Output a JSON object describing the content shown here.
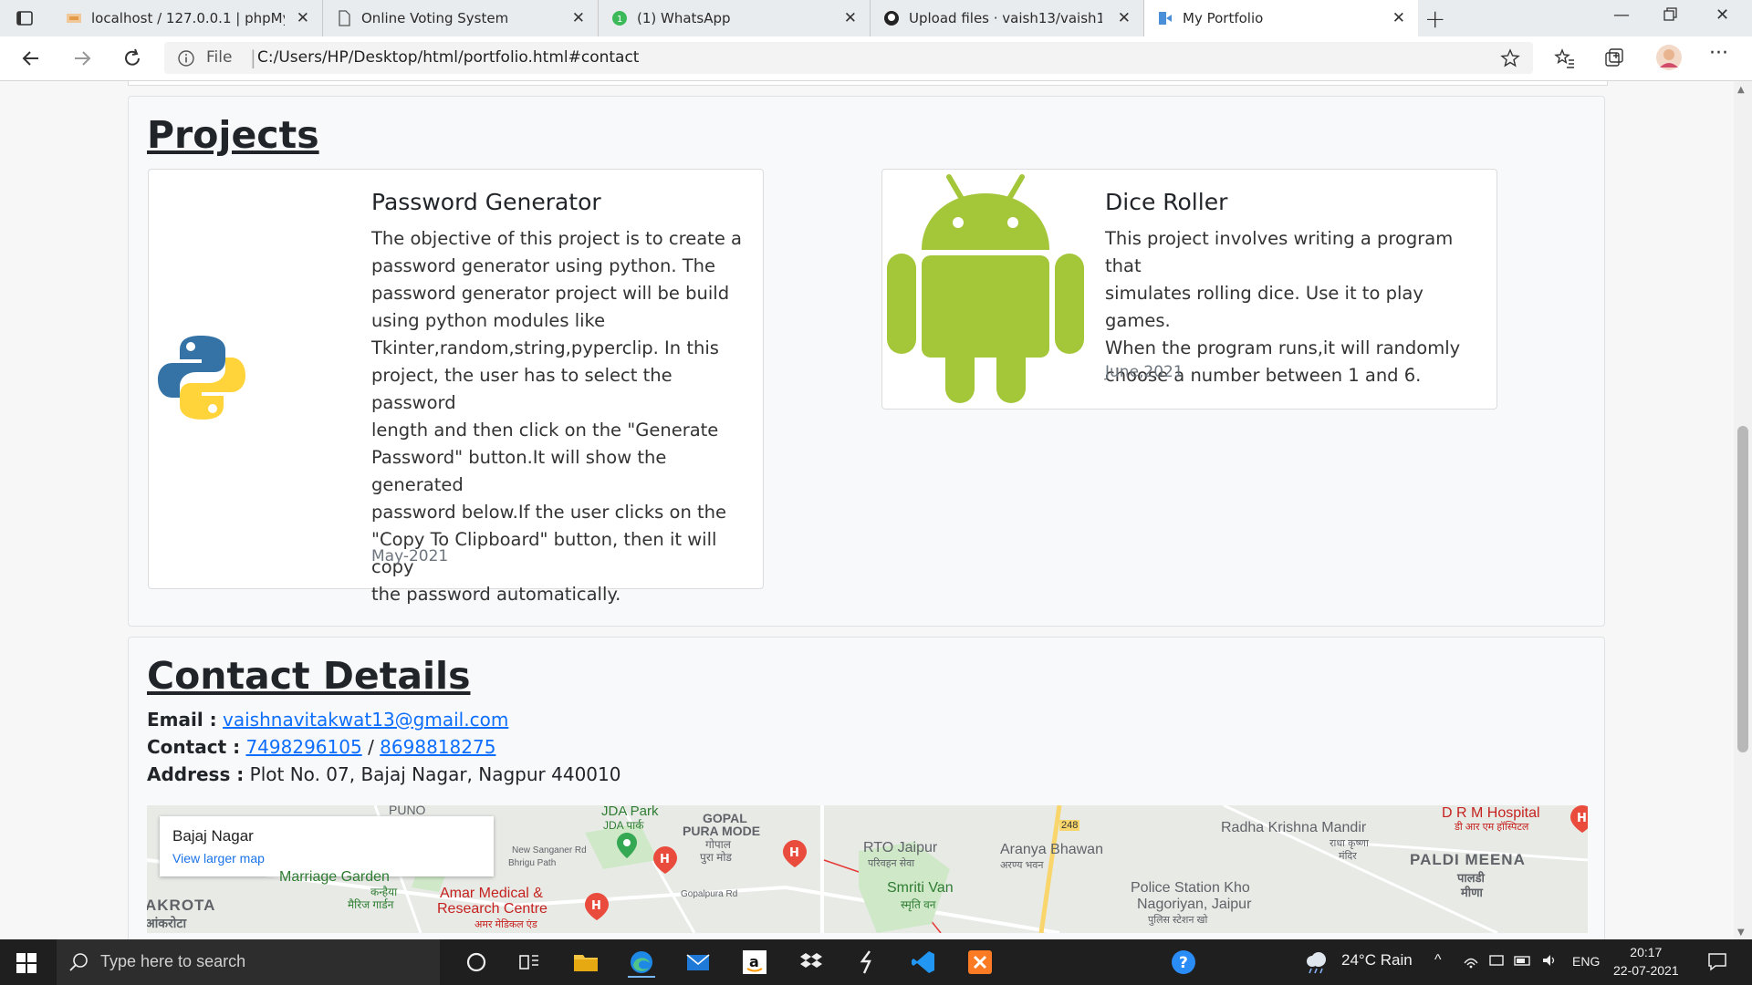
{
  "browser": {
    "tabs": [
      {
        "title": "localhost / 127.0.0.1 | phpMyAdmin",
        "active": false
      },
      {
        "title": "Online Voting System",
        "active": false
      },
      {
        "title": "(1) WhatsApp",
        "active": false
      },
      {
        "title": "Upload files · vaish13/vaish13.github.io",
        "active": false
      },
      {
        "title": "My Portfolio",
        "active": true
      }
    ],
    "address": {
      "scheme_label": "File",
      "url": "C:/Users/HP/Desktop/html/portfolio.html#contact"
    }
  },
  "projects": {
    "heading": "Projects",
    "cards": [
      {
        "icon": "python-logo-icon",
        "title": "Password Generator",
        "lines": [
          "The objective of this project is to create a",
          "password generator using python. The",
          "password generator project will be build",
          "using python modules like",
          "Tkinter,random,string,pyperclip. In this",
          "project, the user has to select the password",
          "length and then click on the \"Generate",
          "Password\" button.It will show the generated",
          "password below.If the user clicks on the",
          "\"Copy To Clipboard\" button, then it will copy",
          "the password automatically."
        ],
        "date": "May-2021"
      },
      {
        "icon": "android-logo-icon",
        "title": "Dice Roller",
        "lines": [
          "This project involves writing a program that",
          "simulates rolling dice. Use it to play games.",
          "When the program runs,it will randomly",
          "choose a number between 1 and 6."
        ],
        "date": "June,2021"
      }
    ]
  },
  "contact": {
    "heading": "Contact Details",
    "email_label": "Email :",
    "email": "vaishnavitakwat13@gmail.com",
    "contact_label": "Contact :",
    "phone1": "7498296105",
    "phone_sep": "/",
    "phone2": "8698818275",
    "address_label": "Address :",
    "address": "Plot No. 07, Bajaj Nagar, Nagpur 440010"
  },
  "map": {
    "place": "Bajaj Nagar",
    "larger_link": "View larger map",
    "labels": {
      "l1": "JDA Park",
      "l2": "JDA पार्क",
      "l3": "GOPAL",
      "l4": "PURA MODE",
      "l5": "गोपाल",
      "l6": "पुरा मोड",
      "l7": "RTO Jaipur",
      "l8": "परिवहन सेवा",
      "l9": "Aranya Bhawan",
      "l10": "अरण्य भवन",
      "l11": "Radha Krishna Mandir",
      "l12": "राधा कृष्णा",
      "l13": "मंदिर",
      "l14": "D R M Hospital",
      "l15": "डी आर एम हॉस्पिटल",
      "l16": "PALDI MEENA",
      "l17": "पालडी",
      "l18": "मीणा",
      "l19": "Police Station Kho",
      "l20": "Nagoriyan, Jaipur",
      "l21": "पुलिस स्टेशन खो",
      "l22": "Smriti Van",
      "l23": "स्मृति वन",
      "l24": "Amar Medical &",
      "l25": "Research Centre",
      "l26": "अमर मेडिकल एंड",
      "l27": "Marriage Garden",
      "l28": "कन्हैया",
      "l29": "मैरिज गार्डन",
      "l30": "AKROTA",
      "l31": "आंकरोटा",
      "l32": "New Sanganer Rd",
      "l33": "Bhrigu Path",
      "l34": "Gopalpura Rd",
      "l35": "248",
      "l36": "PUNO"
    }
  },
  "taskbar": {
    "search_placeholder": "Type here to search",
    "weather": "24°C  Rain",
    "language": "ENG",
    "time": "20:17",
    "date": "22-07-2021"
  }
}
